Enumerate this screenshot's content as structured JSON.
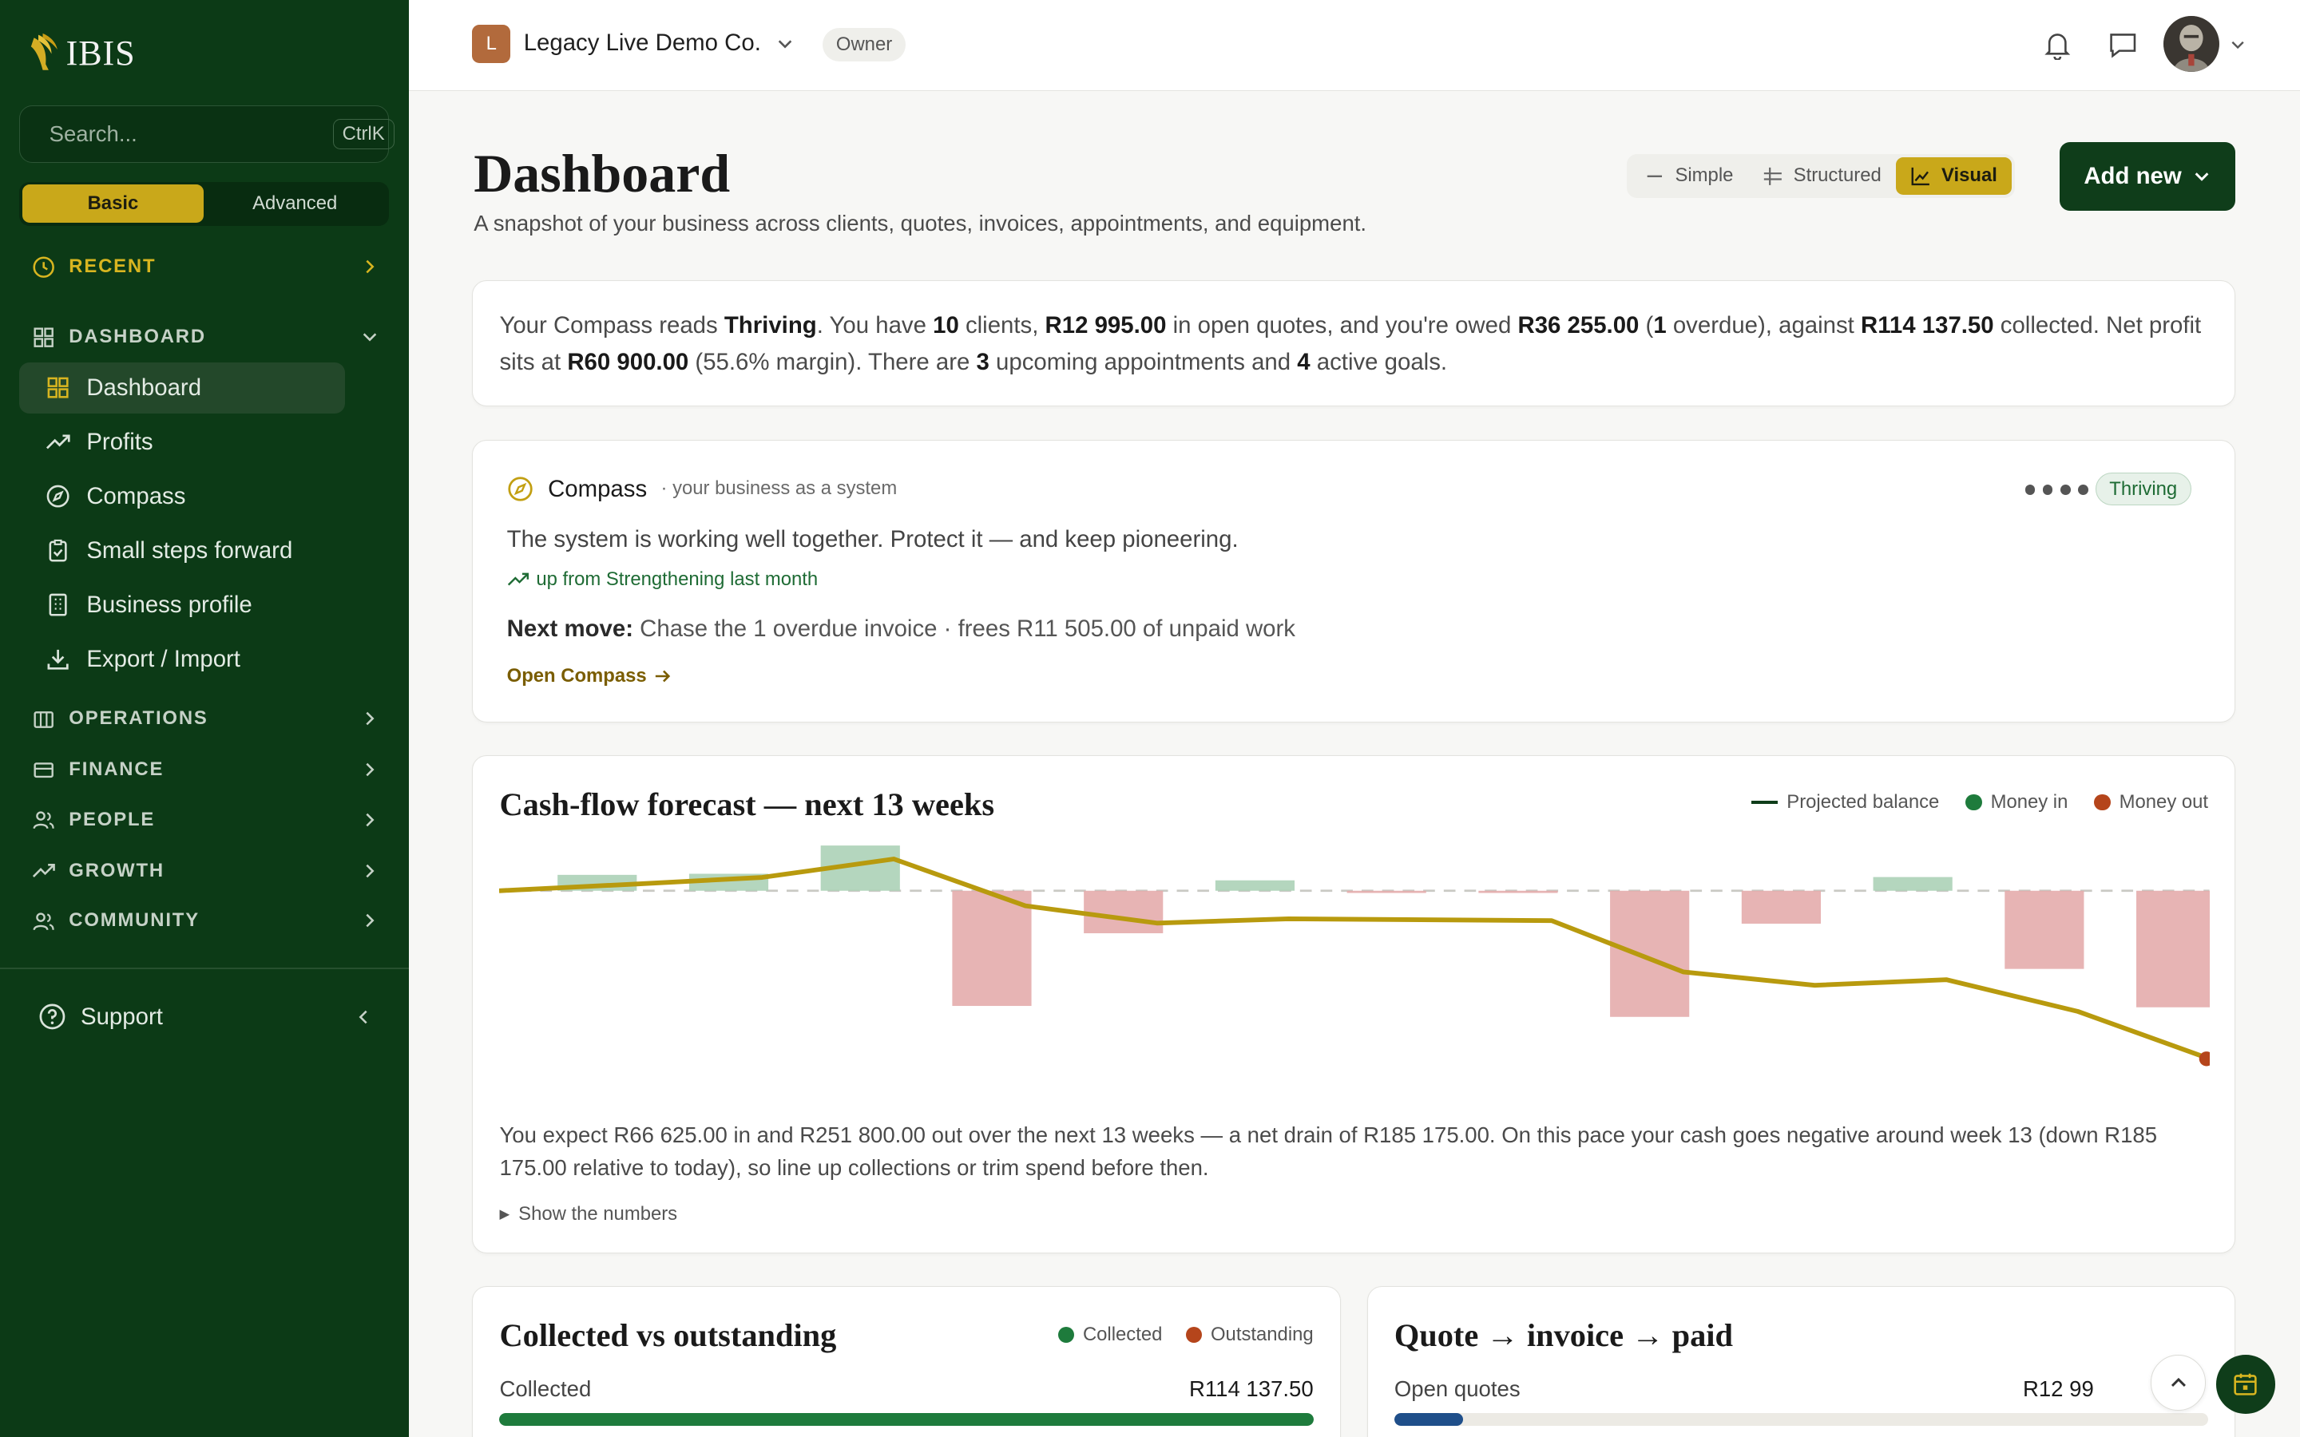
{
  "sidebar": {
    "logo_text": "IBIS",
    "search_placeholder": "Search...",
    "search_shortcut": "CtrlK",
    "modes": [
      "Basic",
      "Advanced"
    ],
    "active_mode": "Basic",
    "sections": {
      "recent": "RECENT",
      "dashboard": "DASHBOARD",
      "operations": "OPERATIONS",
      "finance": "FINANCE",
      "people": "PEOPLE",
      "growth": "GROWTH",
      "community": "COMMUNITY"
    },
    "items": [
      "Dashboard",
      "Profits",
      "Compass",
      "Small steps forward",
      "Business profile",
      "Export / Import"
    ],
    "active_item": "Dashboard",
    "support": "Support"
  },
  "topbar": {
    "org_initial": "L",
    "org_name": "Legacy Live Demo Co.",
    "role": "Owner"
  },
  "page": {
    "title": "Dashboard",
    "subtitle": "A snapshot of your business across clients, quotes, invoices, appointments, and equipment.",
    "views": [
      "Simple",
      "Structured",
      "Visual"
    ],
    "active_view": "Visual",
    "add_new": "Add new"
  },
  "summary": {
    "t1": "Your Compass reads ",
    "status": "Thriving",
    "t2": ". You have ",
    "clients": "10",
    "t3": " clients, ",
    "open_quotes": "R12 995.00",
    "t4": " in open quotes, and you're owed ",
    "owed": "R36 255.00",
    "t5": " (",
    "overdue_count": "1",
    "t6": " overdue), against ",
    "collected": "R114 137.50",
    "t7": " collected. Net profit sits at ",
    "net_profit": "R60 900.00",
    "t8": " (55.6% margin). There are ",
    "appointments": "3",
    "t9": " upcoming appointments and ",
    "goals": "4",
    "t10": " active goals."
  },
  "compass": {
    "title": "Compass",
    "subtitle": "· your business as a system",
    "badge": "Thriving",
    "message": "The system is working well together. Protect it — and keep pioneering.",
    "trend": "up from Strengthening last month",
    "next_label": "Next move:",
    "next_text": " Chase the 1 overdue invoice · frees R11 505.00 of unpaid work",
    "open_link": "Open Compass"
  },
  "cashflow": {
    "title": "Cash-flow forecast — next 13 weeks",
    "legend": {
      "balance": "Projected balance",
      "in": "Money in",
      "out": "Money out"
    },
    "description": "You expect R66 625.00 in and R251 800.00 out over the next 13 weeks — a net drain of R185 175.00. On this pace your cash goes negative around week 13 (down R185 175.00 relative to today), so line up collections or trim spend before then.",
    "toggle": "Show the numbers"
  },
  "chart_data": {
    "type": "bar",
    "title": "Cash-flow forecast — next 13 weeks",
    "weeks": 13,
    "net_flow": [
      5800,
      6200,
      16500,
      -42000,
      -15500,
      3800,
      -800,
      -800,
      -46000,
      -12000,
      5000,
      -28500,
      -42500
    ],
    "projected_balance": [
      0,
      5800,
      12000,
      28500,
      -13500,
      -29000,
      -25200,
      -26000,
      -26800,
      -72800,
      -84800,
      -79800,
      -108300,
      -150800
    ],
    "colors": {
      "in": "#1e7b3c",
      "out": "#b5451b",
      "balance": "#b89a0e"
    }
  },
  "collected_vs_outstanding": {
    "title": "Collected vs outstanding",
    "legend": [
      "Collected",
      "Outstanding"
    ],
    "row_label": "Collected",
    "row_value": "R114 137.50",
    "fill": 1.0
  },
  "quote_flow": {
    "title": "Quote → invoice → paid",
    "row_label": "Open quotes",
    "row_value": "R12 99",
    "fill": 0.085
  },
  "colors": {
    "sidebar": "#0c3a16",
    "accent": "#c9a81a",
    "primary": "#0f3d1a",
    "positive": "#1e7b3c",
    "negative": "#b5451b"
  }
}
